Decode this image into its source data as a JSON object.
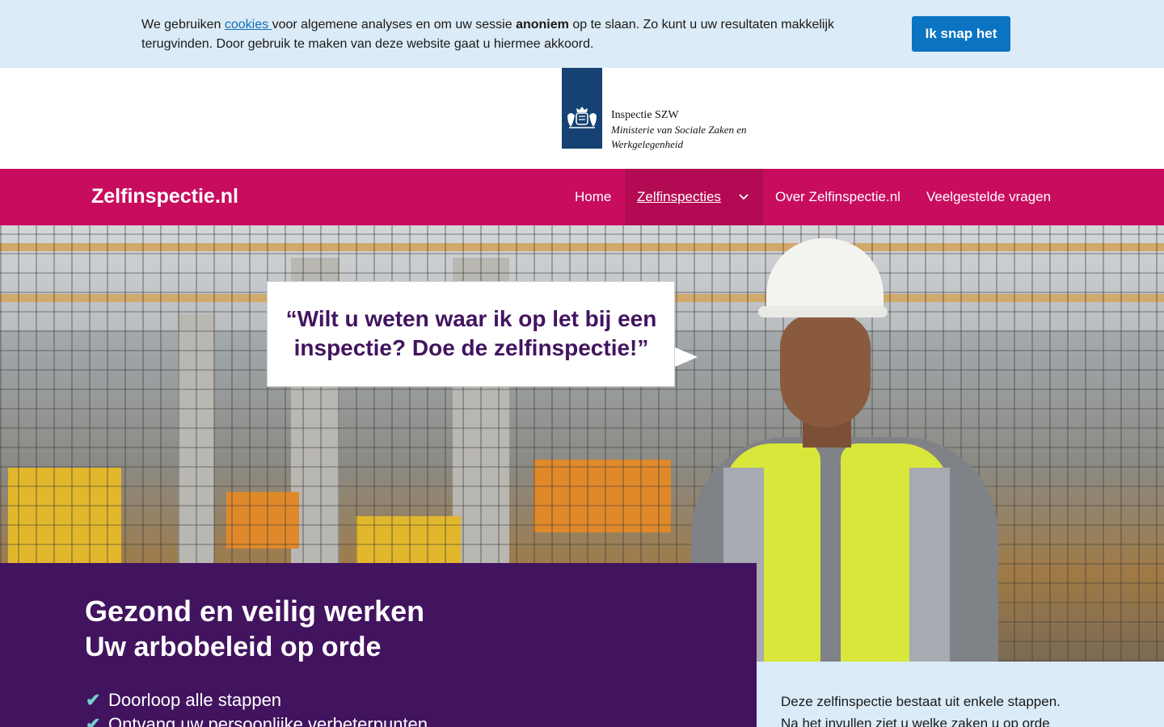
{
  "cookie_bar": {
    "text_before": "We gebruiken ",
    "link_label": "cookies ",
    "text_middle": "voor algemene analyses en om uw sessie ",
    "text_bold": "anoniem",
    "text_after": " op te slaan. Zo kunt u uw resultaten makkelijk terugvinden. Door gebruik te maken van deze website gaat u hiermee akkoord.",
    "button_label": "Ik snap het"
  },
  "logo": {
    "name": "Inspectie SZW",
    "ministry": "Ministerie van Sociale Zaken en Werkgelegenheid",
    "icon": "coat-of-arms-icon"
  },
  "nav": {
    "site_title": "Zelfinspectie.nl",
    "items": [
      {
        "label": "Home",
        "active": false
      },
      {
        "label": "Zelfinspecties",
        "active": true,
        "icon": "chevron-down-icon"
      },
      {
        "label": "Over Zelfinspectie.nl",
        "active": false
      },
      {
        "label": "Veelgestelde vragen",
        "active": false
      }
    ]
  },
  "hero": {
    "quote": "“Wilt u weten waar ik op let bij een inspectie? Doe de zelfinspectie!”"
  },
  "intro": {
    "headline": "Gezond en veilig werken",
    "subheadline": "Uw arbobeleid op orde",
    "checks": [
      "Doorloop alle stappen",
      "Ontvang uw persoonlijke verbeterpunten"
    ]
  },
  "info": {
    "text": "Deze zelfinspectie bestaat uit enkele stappen. Na het invullen ziet u welke zaken u op orde"
  },
  "colors": {
    "cookie_bg": "#dbebf7",
    "cookie_button": "#0b74c2",
    "nav_bg": "#c80d5e",
    "nav_active": "#b30b53",
    "brand_purple": "#42145f",
    "check_color": "#6fd3c7",
    "logo_blue": "#154273"
  }
}
